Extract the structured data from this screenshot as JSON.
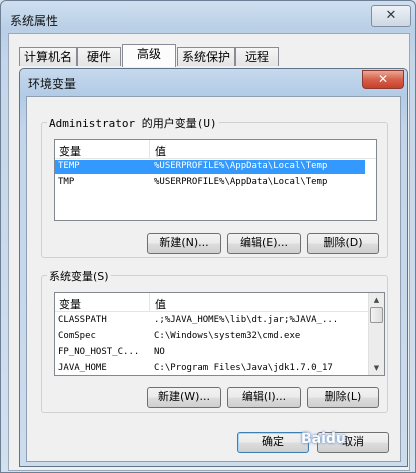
{
  "outer_window": {
    "title": "系统属性",
    "close_glyph": "✕",
    "tabs": [
      "计算机名",
      "硬件",
      "高级",
      "系统保护",
      "远程"
    ],
    "active_tab": "高级"
  },
  "inner_dialog": {
    "title": "环境变量",
    "close_glyph": "✕",
    "user_vars": {
      "label": "Administrator 的用户变量(U)",
      "col_variable": "变量",
      "col_value": "值",
      "rows": [
        {
          "name": "TEMP",
          "value": "%USERPROFILE%\\AppData\\Local\\Temp",
          "selected": true
        },
        {
          "name": "TMP",
          "value": "%USERPROFILE%\\AppData\\Local\\Temp",
          "selected": false
        }
      ],
      "new_label": "新建(N)...",
      "edit_label": "编辑(E)...",
      "delete_label": "删除(D)"
    },
    "system_vars": {
      "label": "系统变量(S)",
      "col_variable": "变量",
      "col_value": "值",
      "rows": [
        {
          "name": "CLASSPATH",
          "value": ".;%JAVA_HOME%\\lib\\dt.jar;%JAVA_..."
        },
        {
          "name": "ComSpec",
          "value": "C:\\Windows\\system32\\cmd.exe"
        },
        {
          "name": "FP_NO_HOST_C...",
          "value": "NO"
        },
        {
          "name": "JAVA_HOME",
          "value": "C:\\Program Files\\Java\\jdk1.7.0_17"
        }
      ],
      "new_label": "新建(W)...",
      "edit_label": "编辑(I)...",
      "delete_label": "删除(L)"
    },
    "ok_label": "确定",
    "cancel_label": "取消"
  },
  "watermark_text": "Baidu"
}
